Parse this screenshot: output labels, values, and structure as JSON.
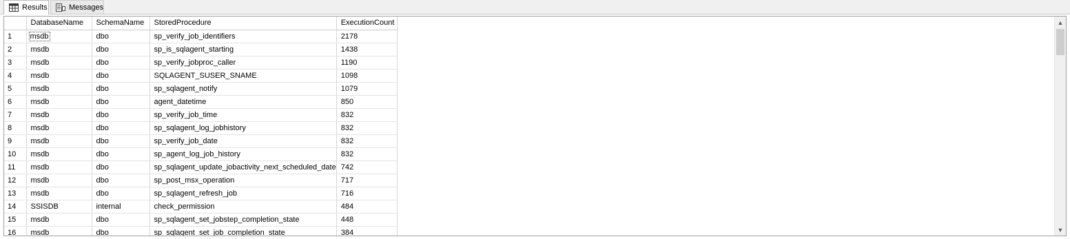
{
  "tabs": [
    {
      "label": "Results",
      "icon": "grid-icon"
    },
    {
      "label": "Messages",
      "icon": "messages-icon"
    }
  ],
  "grid": {
    "columns": [
      "DatabaseName",
      "SchemaName",
      "StoredProcedure",
      "ExecutionCount"
    ],
    "rows": [
      [
        "1",
        "msdb",
        "dbo",
        "sp_verify_job_identifiers",
        "2178"
      ],
      [
        "2",
        "msdb",
        "dbo",
        "sp_is_sqlagent_starting",
        "1438"
      ],
      [
        "3",
        "msdb",
        "dbo",
        "sp_verify_jobproc_caller",
        "1190"
      ],
      [
        "4",
        "msdb",
        "dbo",
        "SQLAGENT_SUSER_SNAME",
        "1098"
      ],
      [
        "5",
        "msdb",
        "dbo",
        "sp_sqlagent_notify",
        "1079"
      ],
      [
        "6",
        "msdb",
        "dbo",
        "agent_datetime",
        "850"
      ],
      [
        "7",
        "msdb",
        "dbo",
        "sp_verify_job_time",
        "832"
      ],
      [
        "8",
        "msdb",
        "dbo",
        "sp_sqlagent_log_jobhistory",
        "832"
      ],
      [
        "9",
        "msdb",
        "dbo",
        "sp_verify_job_date",
        "832"
      ],
      [
        "10",
        "msdb",
        "dbo",
        "sp_agent_log_job_history",
        "832"
      ],
      [
        "11",
        "msdb",
        "dbo",
        "sp_sqlagent_update_jobactivity_next_scheduled_date",
        "742"
      ],
      [
        "12",
        "msdb",
        "dbo",
        "sp_post_msx_operation",
        "717"
      ],
      [
        "13",
        "msdb",
        "dbo",
        "sp_sqlagent_refresh_job",
        "716"
      ],
      [
        "14",
        "SSISDB",
        "internal",
        "check_permission",
        "484"
      ],
      [
        "15",
        "msdb",
        "dbo",
        "sp_sqlagent_set_jobstep_completion_state",
        "448"
      ],
      [
        "16",
        "msdb",
        "dbo",
        "sp_sqlagent_set_job_completion_state",
        "384"
      ]
    ]
  },
  "scrollbar": {
    "up_icon": "chevron-up-icon",
    "down_icon": "chevron-down-icon"
  }
}
